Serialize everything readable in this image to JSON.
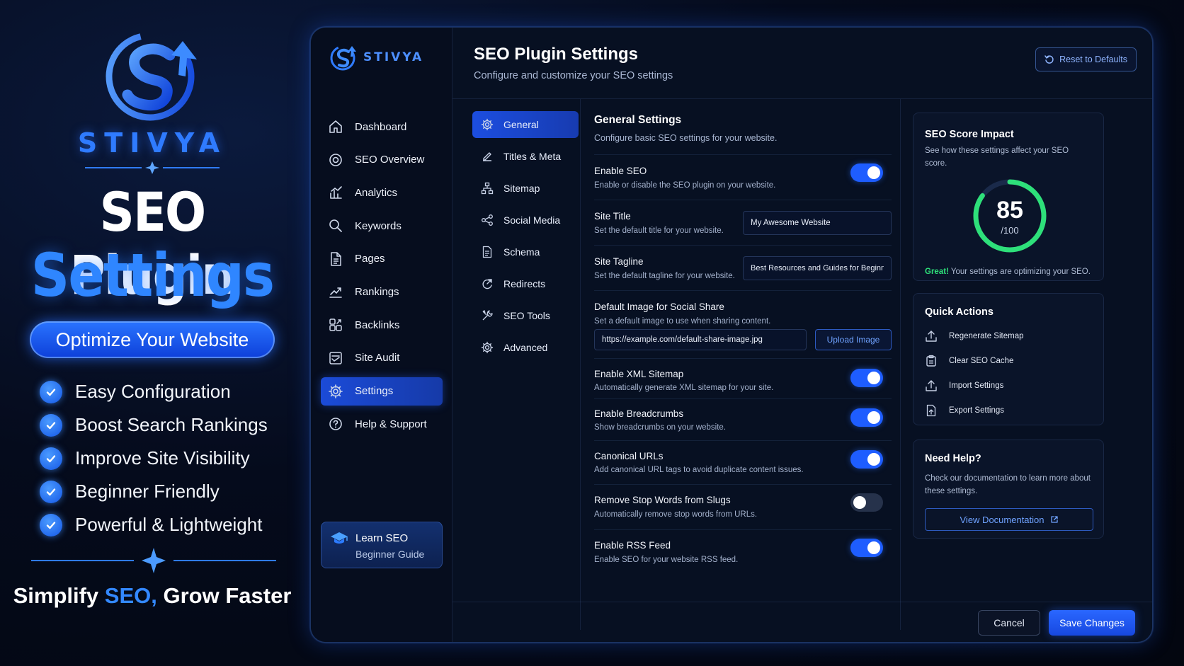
{
  "promo": {
    "brand": "STIVYA",
    "title_line1": "SEO Plugin",
    "title_line2": "Settings",
    "pill": "Optimize Your Website",
    "features": [
      "Easy Configuration",
      "Boost Search Rankings",
      "Improve Site Visibility",
      "Beginner Friendly",
      "Powerful & Lightweight"
    ],
    "tagline_part1": "Simplify ",
    "tagline_highlight": "SEO,",
    "tagline_part2": " Grow Faster"
  },
  "sidebar": {
    "brand": "STIVYA",
    "items": [
      {
        "label": "Dashboard",
        "icon": "home-icon"
      },
      {
        "label": "SEO Overview",
        "icon": "target-icon"
      },
      {
        "label": "Analytics",
        "icon": "analytics-icon"
      },
      {
        "label": "Keywords",
        "icon": "search-icon"
      },
      {
        "label": "Pages",
        "icon": "page-icon"
      },
      {
        "label": "Rankings",
        "icon": "trend-icon"
      },
      {
        "label": "Backlinks",
        "icon": "link-icon"
      },
      {
        "label": "Site Audit",
        "icon": "audit-icon"
      },
      {
        "label": "Settings",
        "icon": "gear-icon",
        "active": true
      },
      {
        "label": "Help & Support",
        "icon": "help-icon"
      }
    ],
    "learn": {
      "title": "Learn SEO",
      "subtitle": "Beginner Guide"
    }
  },
  "header": {
    "title": "SEO Plugin Settings",
    "subtitle": "Configure and customize your SEO settings",
    "reset_label": "Reset to Defaults"
  },
  "subnav": {
    "items": [
      {
        "label": "General",
        "icon": "gear-icon",
        "active": true
      },
      {
        "label": "Titles & Meta",
        "icon": "edit-icon"
      },
      {
        "label": "Sitemap",
        "icon": "sitemap-icon"
      },
      {
        "label": "Social Media",
        "icon": "share-icon"
      },
      {
        "label": "Schema",
        "icon": "document-icon"
      },
      {
        "label": "Redirects",
        "icon": "redirect-icon"
      },
      {
        "label": "SEO Tools",
        "icon": "tools-icon"
      },
      {
        "label": "Advanced",
        "icon": "gear-icon"
      }
    ]
  },
  "general": {
    "title": "General Settings",
    "subtitle": "Configure basic SEO settings for your website.",
    "enable_seo": {
      "title": "Enable SEO",
      "desc": "Enable or disable the SEO plugin on your website.",
      "on": true
    },
    "site_title": {
      "title": "Site Title",
      "desc": "Set the default title for your website.",
      "value": "My Awesome Website"
    },
    "site_tagline": {
      "title": "Site Tagline",
      "desc": "Set the default tagline for your website.",
      "value": "Best Resources and Guides for Beginners"
    },
    "default_image": {
      "title": "Default Image for Social Share",
      "desc": "Set a default image to use when sharing content.",
      "value": "https://example.com/default-share-image.jpg",
      "upload_label": "Upload Image"
    },
    "xml_sitemap": {
      "title": "Enable XML Sitemap",
      "desc": "Automatically generate XML sitemap for your site.",
      "on": true
    },
    "breadcrumbs": {
      "title": "Enable Breadcrumbs",
      "desc": "Show breadcrumbs on your website.",
      "on": true
    },
    "canonical": {
      "title": "Canonical URLs",
      "desc": "Add canonical URL tags to avoid duplicate content issues.",
      "on": true
    },
    "stop_words": {
      "title": "Remove Stop Words from Slugs",
      "desc": "Automatically remove stop words from URLs.",
      "on": false
    },
    "rss_feed": {
      "title": "Enable RSS Feed",
      "desc": "Enable SEO for your website RSS feed.",
      "on": true
    }
  },
  "score": {
    "title": "SEO Score Impact",
    "desc": "See how these settings affect your SEO score.",
    "value": "85",
    "max": "/100",
    "fraction": 0.85,
    "great": "Great!",
    "message": " Your settings are optimizing your SEO."
  },
  "quick_actions": {
    "title": "Quick Actions",
    "items": [
      {
        "label": "Regenerate Sitemap",
        "icon": "upload-icon"
      },
      {
        "label": "Clear SEO Cache",
        "icon": "clipboard-icon"
      },
      {
        "label": "Import Settings",
        "icon": "upload-icon"
      },
      {
        "label": "Export Settings",
        "icon": "export-file-icon"
      }
    ]
  },
  "help": {
    "title": "Need Help?",
    "desc": "Check our documentation to learn more about these settings.",
    "button": "View Documentation"
  },
  "footer": {
    "cancel": "Cancel",
    "save": "Save Changes"
  },
  "colors": {
    "accent": "#1e5dff",
    "success": "#2ee07a",
    "background": "#050b1c"
  }
}
